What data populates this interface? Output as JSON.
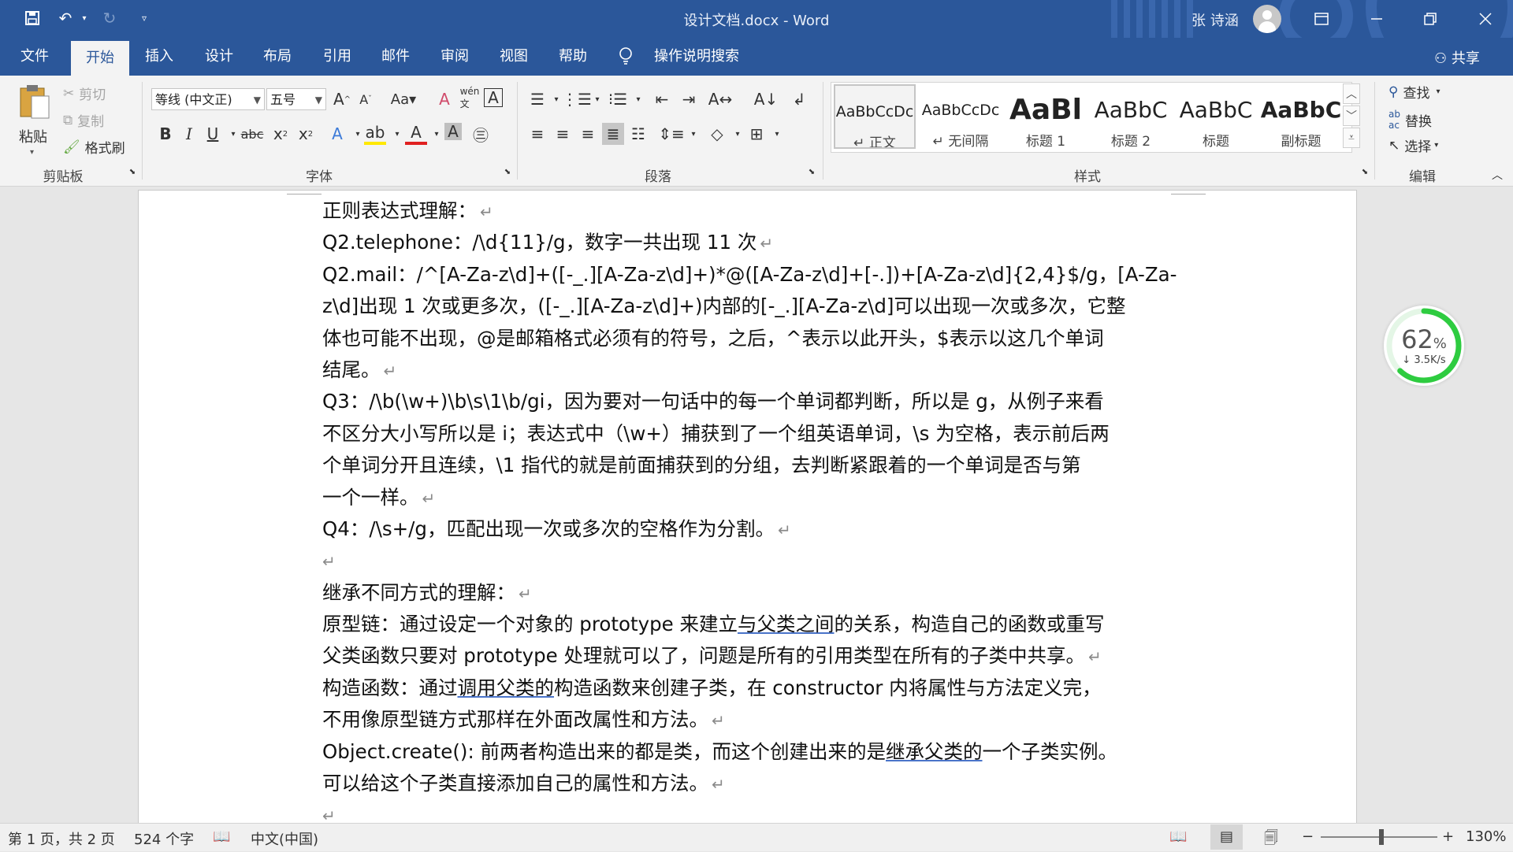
{
  "window": {
    "title": "设计文档.docx  -  Word",
    "user": "张 诗涵",
    "controls": [
      "ribbon-display-icon",
      "minimize-icon",
      "restore-icon",
      "close-icon"
    ]
  },
  "quick_access": [
    "save-icon",
    "undo-icon",
    "redo-icon",
    "customize-icon"
  ],
  "menu": {
    "tabs": [
      "文件",
      "开始",
      "插入",
      "设计",
      "布局",
      "引用",
      "邮件",
      "审阅",
      "视图",
      "帮助"
    ],
    "active_tab": "开始",
    "search": "操作说明搜索",
    "share": "共享"
  },
  "ribbon": {
    "clipboard": {
      "paste": "粘贴",
      "cut": "剪切",
      "copy": "复制",
      "format_painter": "格式刷",
      "label": "剪贴板"
    },
    "font": {
      "font_name": "等线 (中文正)",
      "font_size": "五号",
      "label": "字体"
    },
    "paragraph": {
      "label": "段落"
    },
    "styles": {
      "items": [
        {
          "sample": "AaBbCcDc",
          "name": "↵ 正文"
        },
        {
          "sample": "AaBbCcDc",
          "name": "↵ 无间隔"
        },
        {
          "sample": "AaBl",
          "name": "标题 1"
        },
        {
          "sample": "AaBbC",
          "name": "标题 2"
        },
        {
          "sample": "AaBbC",
          "name": "标题"
        },
        {
          "sample": "AaBbC",
          "name": "副标题"
        }
      ],
      "label": "样式"
    },
    "editing": {
      "find": "查找",
      "replace": "替换",
      "select": "选择",
      "label": "编辑"
    }
  },
  "document": {
    "lines": [
      "正则表达式理解：",
      "Q2.telephone：/\\d{11}/g，数字一共出现 11 次",
      "Q2.mail：/^[A-Za-z\\d]+([-_.][A-Za-z\\d]+)*@([A-Za-z\\d]+[-.])+[A-Za-z\\d]{2,4}$/g，[A-Za-",
      "z\\d]出现 1 次或更多次，([-_.][A-Za-z\\d]+)内部的[-_.][A-Za-z\\d]可以出现一次或多次，它整",
      "体也可能不出现，@是邮箱格式必须有的符号，之后，^表示以此开头，$表示以这几个单词",
      "结尾。",
      "Q3：/\\b(\\w+)\\b\\s\\1\\b/gi，因为要对一句话中的每一个单词都判断，所以是 g，从例子来看",
      "不区分大小写所以是 i；表达式中（\\w+）捕获到了一个组英语单词，\\s 为空格，表示前后两",
      "个单词分开且连续，\\1  指代的就是前面捕获到的分组，去判断紧跟着的一个单词是否与第",
      "一个一样。",
      "Q4：/\\s+/g，匹配出现一次或多次的空格作为分割。",
      "",
      "继承不同方式的理解：",
      "原型链：通过设定一个对象的 prototype 来建立与父类之间的关系，构造自己的函数或重写",
      "父类函数只要对 prototype 处理就可以了，问题是所有的引用类型在所有的子类中共享。",
      "构造函数：通过调用父类的构造函数来创建子类，在 constructor 内将属性与方法定义完，",
      "不用像原型链方式那样在外面改属性和方法。",
      "Object.create(): 前两者构造出来的都是类，而这个创建出来的是继承父类的一个子类实例。",
      "可以给这个子类直接添加自己的属性和方法。",
      ""
    ],
    "paragraph_mark": "↵"
  },
  "net_widget": {
    "percent": "62",
    "percent_unit": "%",
    "speed": "↓ 3.5K/s",
    "level": 0.62
  },
  "status": {
    "page": "第 1 页，共 2 页",
    "words": "524 个字",
    "language": "中文(中国)",
    "zoom": "130%",
    "zoom_minus": "−",
    "zoom_plus": "+"
  },
  "colors": {
    "brand": "#2b579a",
    "ribbon_bg": "#f3f3f3",
    "widget_ring": "#2ecc40"
  }
}
